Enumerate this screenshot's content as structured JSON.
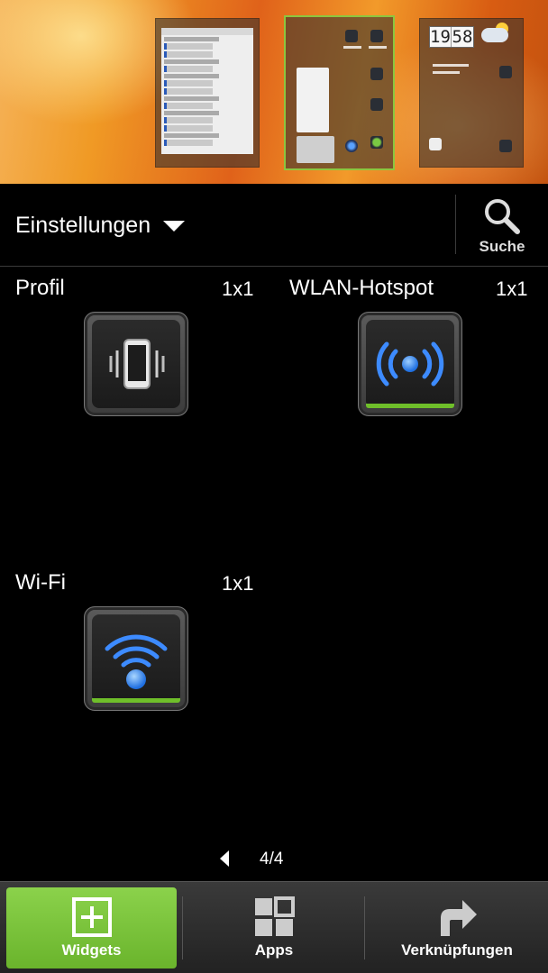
{
  "preview": {
    "screens": [
      {
        "name": "screen-1",
        "active": false
      },
      {
        "name": "screen-2",
        "active": true
      },
      {
        "name": "screen-3",
        "active": false
      }
    ],
    "clock": {
      "hours": "19",
      "minutes": "58"
    }
  },
  "header": {
    "category": "Einstellungen",
    "search_label": "Suche"
  },
  "widgets": [
    {
      "name": "Profil",
      "size": "1x1",
      "icon": "vibrate-phone-icon"
    },
    {
      "name": "WLAN-Hotspot",
      "size": "1x1",
      "icon": "hotspot-icon"
    },
    {
      "name": "Wi-Fi",
      "size": "1x1",
      "icon": "wifi-icon"
    }
  ],
  "pager": {
    "text": "4/4"
  },
  "tabs": [
    {
      "label": "Widgets",
      "icon": "add-widget-icon",
      "active": true
    },
    {
      "label": "Apps",
      "icon": "apps-grid-icon",
      "active": false
    },
    {
      "label": "Verknüpfungen",
      "icon": "shortcut-arrow-icon",
      "active": false
    }
  ],
  "colors": {
    "accent": "#6fbf2a",
    "active_tab": "#7cc63e",
    "icon_blue": "#3d8bff"
  }
}
